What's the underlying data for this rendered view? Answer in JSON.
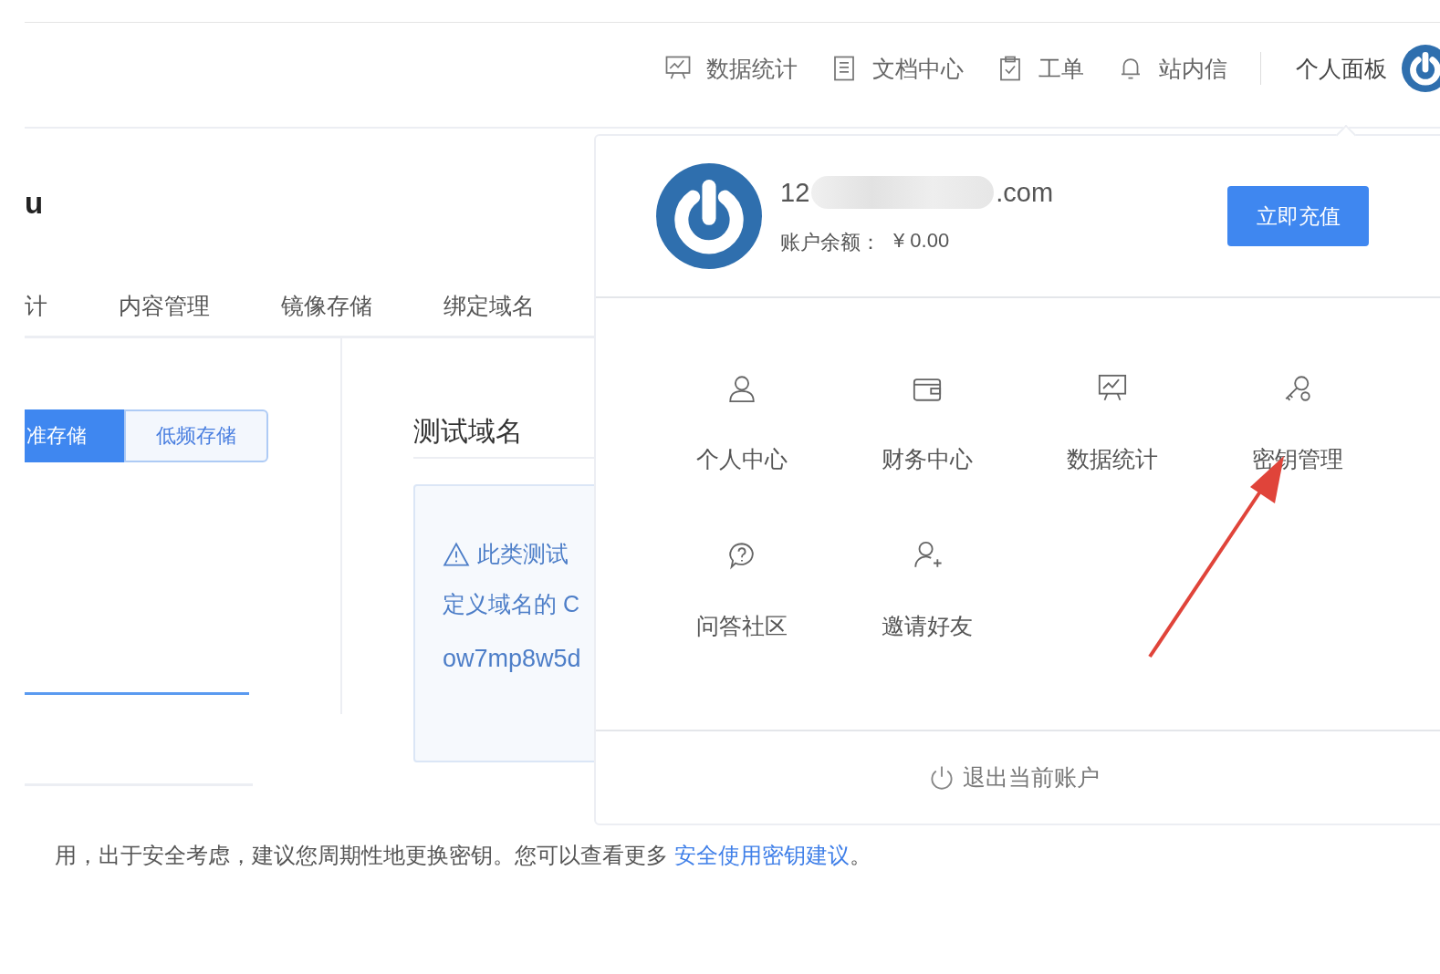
{
  "header": {
    "nav": [
      {
        "label": "数据统计"
      },
      {
        "label": "文档中心"
      },
      {
        "label": "工单"
      },
      {
        "label": "站内信"
      }
    ],
    "account_label": "个人面板"
  },
  "page": {
    "title": "u",
    "tabs": [
      "计",
      "内容管理",
      "镜像存储",
      "绑定域名"
    ],
    "storage_types": [
      {
        "label": "准存储",
        "selected": true
      },
      {
        "label": "低频存储",
        "selected": false
      }
    ],
    "test_domain": {
      "heading": "测试域名",
      "notice_lines": [
        "此类测试",
        "定义域名的 C"
      ],
      "domain": "ow7mp8w5d"
    },
    "footer_note": {
      "text": "用，出于安全考虑，建议您周期性地更换密钥。您可以查看更多 ",
      "link": "安全使用密钥建议",
      "end": "。"
    }
  },
  "account_menu": {
    "email_start": "12",
    "email_end": ".com",
    "balance_label": "账户余额：",
    "balance": "¥ 0.00",
    "recharge_button": "立即充值",
    "items": [
      {
        "label": "个人中心"
      },
      {
        "label": "财务中心"
      },
      {
        "label": "数据统计"
      },
      {
        "label": "密钥管理"
      },
      {
        "label": "问答社区"
      },
      {
        "label": "邀请好友"
      }
    ],
    "logout": "退出当前账户"
  }
}
